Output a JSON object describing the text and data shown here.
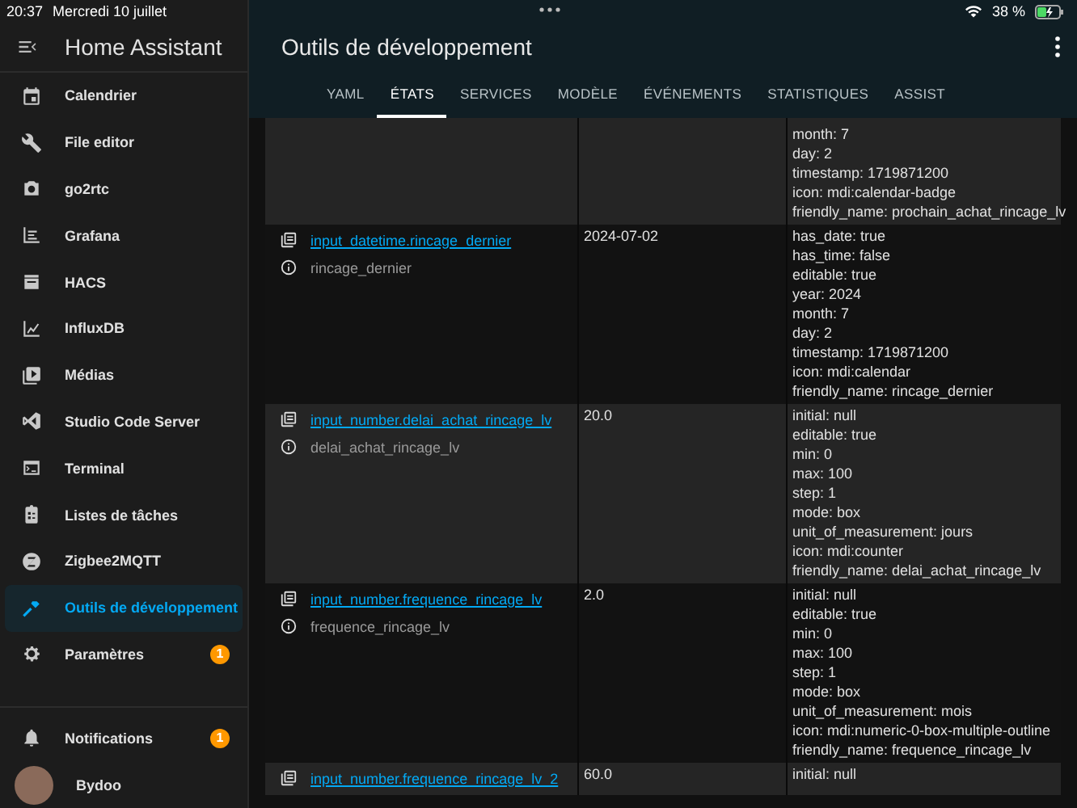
{
  "status_bar": {
    "time": "20:37",
    "date": "Mercredi 10 juillet",
    "battery": "38 %"
  },
  "sidebar": {
    "title": "Home Assistant",
    "items": [
      {
        "label": "Calendrier",
        "selected": false
      },
      {
        "label": "File editor",
        "selected": false
      },
      {
        "label": "go2rtc",
        "selected": false
      },
      {
        "label": "Grafana",
        "selected": false
      },
      {
        "label": "HACS",
        "selected": false
      },
      {
        "label": "InfluxDB",
        "selected": false
      },
      {
        "label": "Médias",
        "selected": false
      },
      {
        "label": "Studio Code Server",
        "selected": false
      },
      {
        "label": "Terminal",
        "selected": false
      },
      {
        "label": "Listes de tâches",
        "selected": false
      },
      {
        "label": "Zigbee2MQTT",
        "selected": false
      },
      {
        "label": "Outils de développement",
        "selected": true
      },
      {
        "label": "Paramètres",
        "selected": false,
        "badge": "1"
      }
    ],
    "notifications": {
      "label": "Notifications",
      "badge": "1"
    },
    "user": {
      "name": "Bydoo"
    }
  },
  "header": {
    "title": "Outils de développement",
    "tabs": [
      {
        "label": "YAML",
        "selected": false
      },
      {
        "label": "ÉTATS",
        "selected": true
      },
      {
        "label": "SERVICES",
        "selected": false
      },
      {
        "label": "MODÈLE",
        "selected": false
      },
      {
        "label": "ÉVÉNEMENTS",
        "selected": false
      },
      {
        "label": "STATISTIQUES",
        "selected": false
      },
      {
        "label": "ASSIST",
        "selected": false
      }
    ]
  },
  "table": {
    "rows": [
      {
        "attributes": [
          "month: 7",
          "day: 2",
          "timestamp: 1719871200",
          "icon: mdi:calendar-badge",
          "friendly_name: prochain_achat_rincage_lv"
        ]
      },
      {
        "entity": "input_datetime.rincage_dernier",
        "name": "rincage_dernier",
        "state": "2024-07-02",
        "attributes": [
          "has_date: true",
          "has_time: false",
          "editable: true",
          "year: 2024",
          "month: 7",
          "day: 2",
          "timestamp: 1719871200",
          "icon: mdi:calendar",
          "friendly_name: rincage_dernier"
        ]
      },
      {
        "entity": "input_number.delai_achat_rincage_lv",
        "name": "delai_achat_rincage_lv",
        "state": "20.0",
        "attributes": [
          "initial: null",
          "editable: true",
          "min: 0",
          "max: 100",
          "step: 1",
          "mode: box",
          "unit_of_measurement: jours",
          "icon: mdi:counter",
          "friendly_name: delai_achat_rincage_lv"
        ]
      },
      {
        "entity": "input_number.frequence_rincage_lv",
        "name": "frequence_rincage_lv",
        "state": "2.0",
        "attributes": [
          "initial: null",
          "editable: true",
          "min: 0",
          "max: 100",
          "step: 1",
          "mode: box",
          "unit_of_measurement: mois",
          "icon: mdi:numeric-0-box-multiple-outline",
          "friendly_name: frequence_rincage_lv"
        ]
      },
      {
        "entity": "input_number.frequence_rincage_lv_2",
        "state": "60.0",
        "attributes": [
          "initial: null"
        ]
      }
    ]
  }
}
